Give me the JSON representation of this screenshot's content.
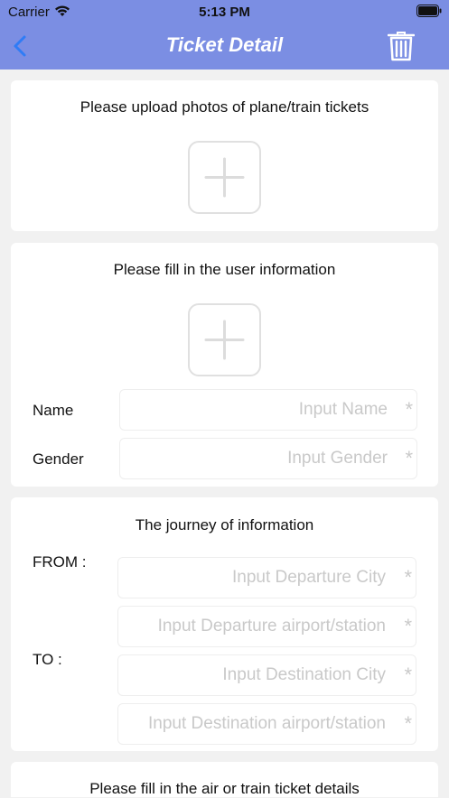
{
  "status_bar": {
    "carrier": "Carrier",
    "time": "5:13 PM"
  },
  "nav": {
    "title": "Ticket Detail",
    "back_icon": "chevron-left-icon",
    "delete_icon": "trash-icon"
  },
  "colors": {
    "nav_background": "#7b8ee3",
    "back_icon": "#2f7cf6",
    "page_background": "#f1f1f1",
    "placeholder": "#c9c9c9"
  },
  "upload_card": {
    "title": "Please upload photos of plane/train tickets",
    "upload_icon": "plus-icon"
  },
  "user_card": {
    "title": "Please fill in the user information",
    "upload_icon": "plus-icon",
    "name_label": "Name",
    "name_placeholder": "Input Name",
    "gender_label": "Gender",
    "gender_placeholder": "Input Gender",
    "required_mark": "*"
  },
  "journey_card": {
    "title": "The journey of information",
    "from_label": "FROM :",
    "to_label": "TO :",
    "departure_city_placeholder": "Input Departure City",
    "departure_station_placeholder": "Input Departure airport/station",
    "destination_city_placeholder": "Input Destination City",
    "destination_station_placeholder": "Input Destination airport/station",
    "required_mark": "*"
  },
  "ticket_card": {
    "title": "Please fill in the air or train ticket details"
  }
}
